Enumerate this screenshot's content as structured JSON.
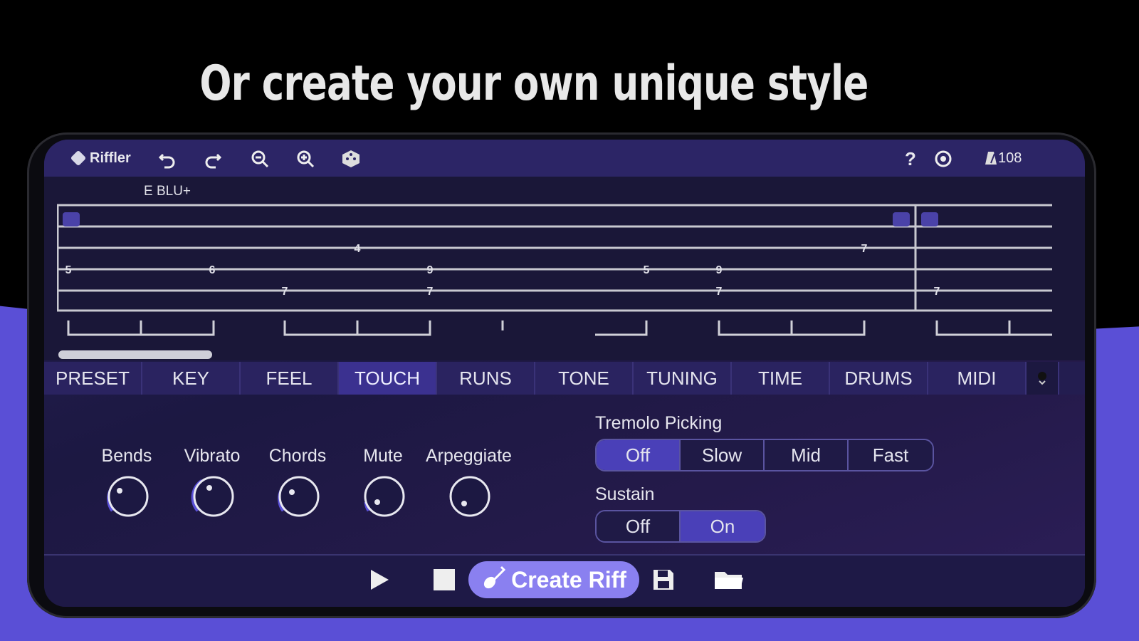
{
  "headline": "Or create your own unique style",
  "toolbar": {
    "app_name": "Riffler",
    "icons": [
      "undo-icon",
      "redo-icon",
      "zoom-out-icon",
      "zoom-in-icon",
      "dice-icon",
      "help-icon",
      "settings-icon",
      "metronome-icon"
    ],
    "tempo": "108"
  },
  "tab_view": {
    "tuning": "E BLU+",
    "notes": [
      {
        "string": 2,
        "fret": "4"
      },
      {
        "string": 3,
        "fret": "5"
      },
      {
        "string": 3,
        "fret": "6"
      },
      {
        "string": 4,
        "fret": "7"
      },
      {
        "string": 3,
        "fret": "9"
      },
      {
        "string": 4,
        "fret": "7"
      },
      {
        "string": 3,
        "fret": "5"
      },
      {
        "string": 3,
        "fret": "9"
      },
      {
        "string": 4,
        "fret": "7"
      },
      {
        "string": 2,
        "fret": "7"
      },
      {
        "string": 4,
        "fret": "7"
      }
    ]
  },
  "tabs": {
    "items": [
      "PRESET",
      "KEY",
      "FEEL",
      "TOUCH",
      "RUNS",
      "TONE",
      "TUNING",
      "TIME",
      "DRUMS",
      "MIDI"
    ],
    "active": "TOUCH"
  },
  "touch": {
    "knobs": [
      {
        "label": "Bends"
      },
      {
        "label": "Vibrato"
      },
      {
        "label": "Chords"
      },
      {
        "label": "Mute"
      },
      {
        "label": "Arpeggiate"
      }
    ],
    "tremolo": {
      "label": "Tremolo Picking",
      "options": [
        "Off",
        "Slow",
        "Mid",
        "Fast"
      ],
      "selected": "Off"
    },
    "sustain": {
      "label": "Sustain",
      "options": [
        "Off",
        "On"
      ],
      "selected": "On"
    }
  },
  "bottom": {
    "create_label": "Create Riff"
  },
  "colors": {
    "accent": "#8a80f0",
    "toolbar": "#2c2566",
    "active_tab": "#3b3190",
    "background_band": "#5a4fd6"
  }
}
